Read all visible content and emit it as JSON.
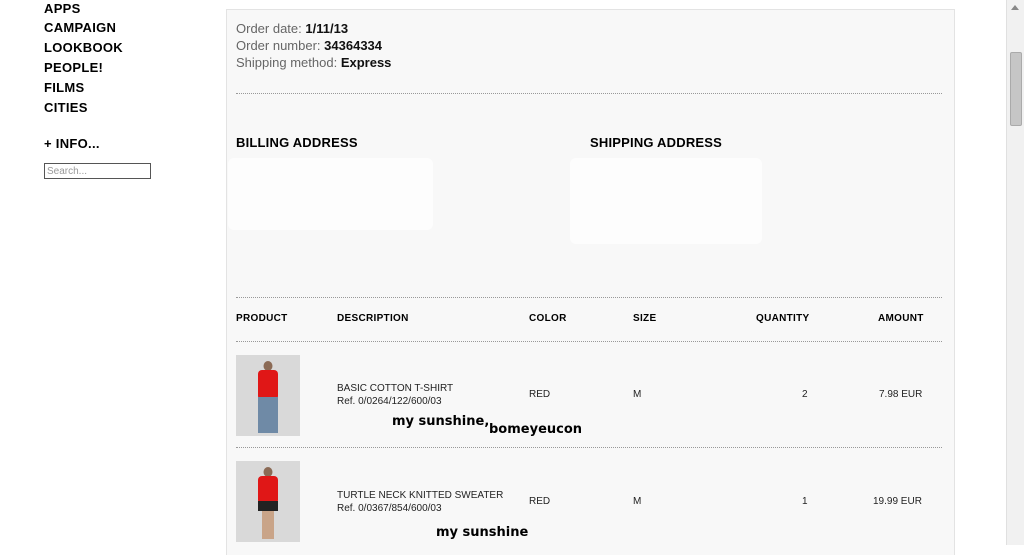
{
  "nav": {
    "items": [
      "APPS",
      "CAMPAIGN",
      "LOOKBOOK",
      "PEOPLE!",
      "FILMS",
      "CITIES"
    ],
    "info": "+ INFO...",
    "search_placeholder": "Search..."
  },
  "order": {
    "date_label": "Order date:",
    "date": "1/11/13",
    "number_label": "Order number:",
    "number": "34364334",
    "shipping_label": "Shipping method:",
    "shipping": "Express"
  },
  "addresses": {
    "billing_title": "BILLING ADDRESS",
    "shipping_title": "SHIPPING ADDRESS"
  },
  "table": {
    "headers": [
      "PRODUCT",
      "DESCRIPTION",
      "COLOR",
      "SIZE",
      "QUANTITY",
      "AMOUNT"
    ],
    "rows": [
      {
        "name": "BASIC COTTON T-SHIRT",
        "ref": "Ref. 0/0264/122/600/03",
        "color": "RED",
        "size": "M",
        "quantity": "2",
        "amount": "7.98 EUR"
      },
      {
        "name": "TURTLE NECK KNITTED SWEATER",
        "ref": "Ref. 0/0367/854/600/03",
        "color": "RED",
        "size": "M",
        "quantity": "1",
        "amount": "19.99 EUR"
      }
    ]
  },
  "annotations": {
    "note1a": "my sunshine,",
    "note1b": "bomeyeucon",
    "note2": "my sunshine"
  },
  "colors": {
    "panel_bg": "#f8f8f8",
    "product_red": "#e01717"
  }
}
